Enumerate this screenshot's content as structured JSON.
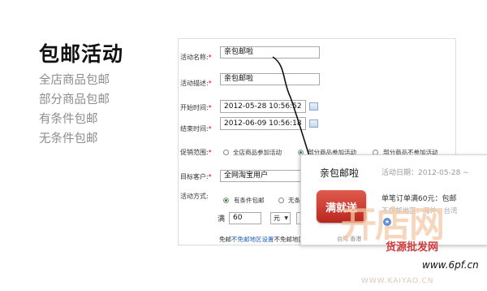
{
  "title": "包邮活动",
  "features": [
    "全店商品包邮",
    "部分商品包邮",
    "有条件包邮",
    "无条件包邮"
  ],
  "form": {
    "name_label": "活动名称:",
    "name_value": "亲包邮啦",
    "desc_label": "活动描述:",
    "desc_value": "亲包邮啦",
    "start_label": "开始时间:",
    "start_value": "2012-05-28 10:56:52",
    "end_label": "结束时间:",
    "end_value": "2012-06-09 10:56:18",
    "scope_label": "促销范围:",
    "scope_options": [
      "全店商品参加活动",
      "部分商品参加活动",
      "部分商品不参加活动"
    ],
    "scope_selected": 1,
    "customer_label": "目标客户:",
    "customer_value": "全网淘宝用户",
    "method_label": "活动方式:",
    "method_options": [
      "有条件包邮",
      "无条件包邮"
    ],
    "method_selected": 0,
    "threshold_prefix": "满",
    "threshold_value": "60",
    "threshold_unit": "元",
    "required_mark": "*",
    "footnote_prefix": "免邮",
    "footnote_link1": "不免邮地区设置",
    "footnote_mid": "不免邮地区：海外",
    "footnote_tail": "台湾  香港"
  },
  "popup": {
    "title": "亲包邮啦",
    "date_label": "活动日期：2012-05-28 ~",
    "stamp_text": "满就送",
    "desc": "单笔订单满60元：包邮",
    "region": "不包邮地区：海外，台湾"
  },
  "watermark": {
    "logo": "开店网",
    "sub": "货源批发网",
    "url": "www.6pf.cn",
    "url2": "WWW.KAIYAO.CN"
  },
  "colors": {
    "required": "#e00000",
    "link": "#1f5fb5",
    "stamp": "#c8342a",
    "features": "#8c8c8c"
  }
}
